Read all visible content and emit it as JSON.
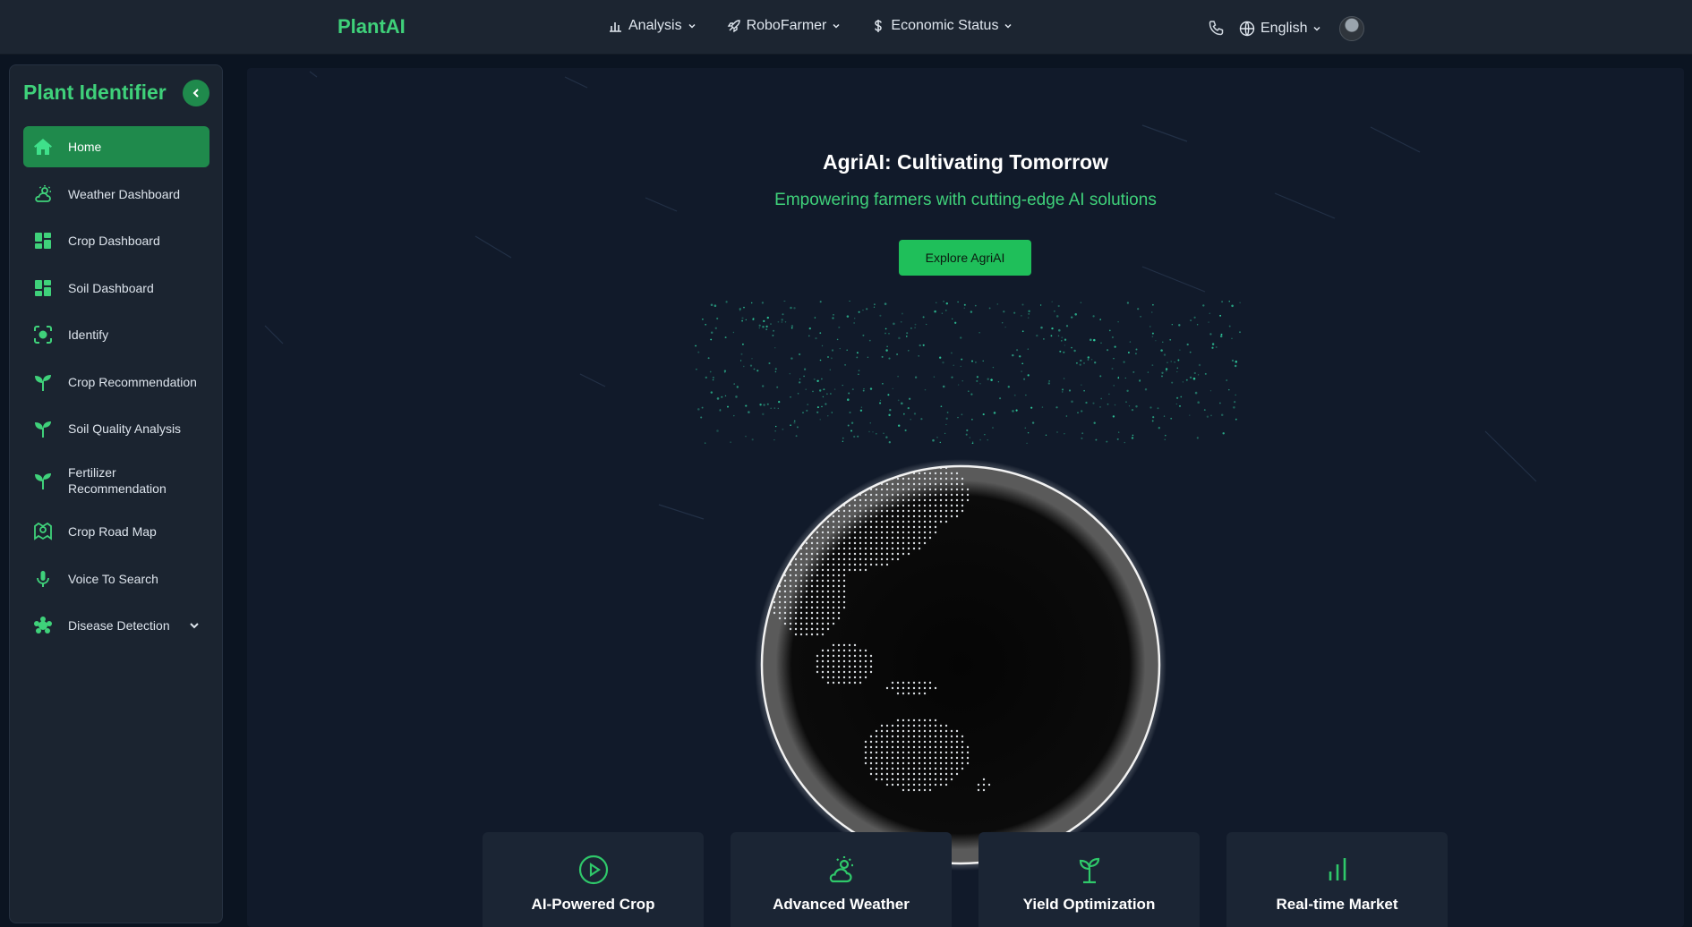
{
  "header": {
    "brand": "PlantAI",
    "nav": [
      {
        "label": "Analysis"
      },
      {
        "label": "RoboFarmer"
      },
      {
        "label": "Economic Status"
      }
    ],
    "language": "English"
  },
  "sidebar": {
    "title": "Plant Identifier",
    "items": [
      {
        "label": "Home",
        "icon": "home-icon"
      },
      {
        "label": "Weather Dashboard",
        "icon": "weather-icon"
      },
      {
        "label": "Crop Dashboard",
        "icon": "dashboard-icon"
      },
      {
        "label": "Soil Dashboard",
        "icon": "dashboard-icon"
      },
      {
        "label": "Identify",
        "icon": "scan-icon"
      },
      {
        "label": "Crop Recommendation",
        "icon": "sprout-icon"
      },
      {
        "label": "Soil Quality Analysis",
        "icon": "sprout-icon"
      },
      {
        "label": "Fertilizer Recommendation",
        "icon": "sprout-icon"
      },
      {
        "label": "Crop Road Map",
        "icon": "map-pin-icon"
      },
      {
        "label": "Voice To Search",
        "icon": "microphone-icon"
      },
      {
        "label": "Disease Detection",
        "icon": "bug-icon"
      }
    ]
  },
  "hero": {
    "title": "AgriAI: Cultivating Tomorrow",
    "subtitle": "Empowering farmers with cutting-edge AI solutions",
    "cta": "Explore AgriAI"
  },
  "features": [
    {
      "title": "AI-Powered Crop",
      "icon": "play-circle-icon"
    },
    {
      "title": "Advanced Weather",
      "icon": "sun-cloud-icon"
    },
    {
      "title": "Yield Optimization",
      "icon": "sprout-icon"
    },
    {
      "title": "Real-time Market",
      "icon": "bar-chart-icon"
    }
  ],
  "colors": {
    "accent": "#3fd17a",
    "active": "#1f8a4c",
    "button": "#1fbf5a"
  }
}
